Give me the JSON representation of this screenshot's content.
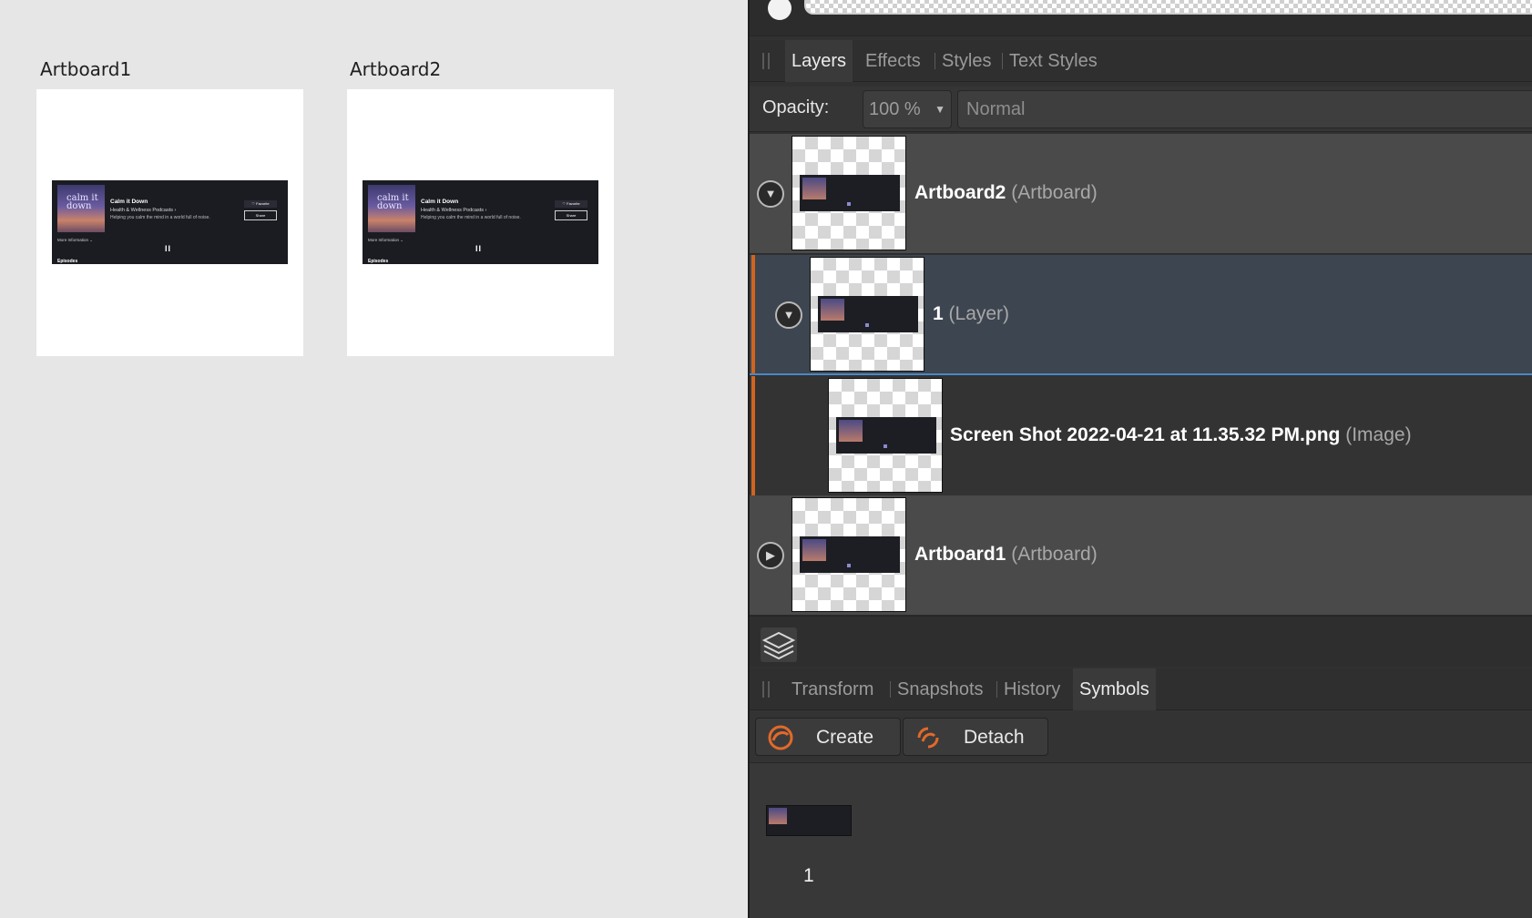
{
  "canvas": {
    "artboards": [
      {
        "title": "Artboard1",
        "podcast": {
          "cover_text": "calm it down",
          "title": "Calm it Down",
          "category": "Health & Wellness Podcasts ›",
          "description": "Helping you calm the mind in a world full of noise.",
          "favorite_label": "♡ Favorite",
          "share_label": "Share",
          "more_info": "More Information ⌄",
          "pause": "II",
          "episodes": "Episodes"
        }
      },
      {
        "title": "Artboard2",
        "podcast": {
          "cover_text": "calm it down",
          "title": "Calm it Down",
          "category": "Health & Wellness Podcasts ›",
          "description": "Helping you calm the mind in a world full of noise.",
          "favorite_label": "♡ Favorite",
          "share_label": "Share",
          "more_info": "More Information ⌄",
          "pause": "II",
          "episodes": "Episodes"
        }
      }
    ]
  },
  "panel": {
    "top_tabs": [
      "Layers",
      "Effects",
      "Styles",
      "Text Styles"
    ],
    "active_top_tab": "Layers",
    "opacity_label": "Opacity:",
    "opacity_value": "100 %",
    "blend_mode": "Normal",
    "layers": [
      {
        "name": "Artboard2",
        "type": "(Artboard)",
        "expanded": true
      },
      {
        "name": "1",
        "type": "(Layer)",
        "expanded": true,
        "selected": true
      },
      {
        "name": "Screen Shot 2022-04-21 at 11.35.32 PM.png",
        "type": "(Image)"
      },
      {
        "name": "Artboard1",
        "type": "(Artboard)",
        "expanded": false
      }
    ],
    "bottom_tabs": [
      "Transform",
      "Snapshots",
      "History",
      "Symbols"
    ],
    "active_bottom_tab": "Symbols",
    "symbol_buttons": {
      "create": "Create",
      "detach": "Detach"
    },
    "symbols": [
      {
        "label": "1"
      }
    ],
    "colors": {
      "accent_orange": "#d0641f",
      "selection_blue": "#4a88c7"
    }
  }
}
